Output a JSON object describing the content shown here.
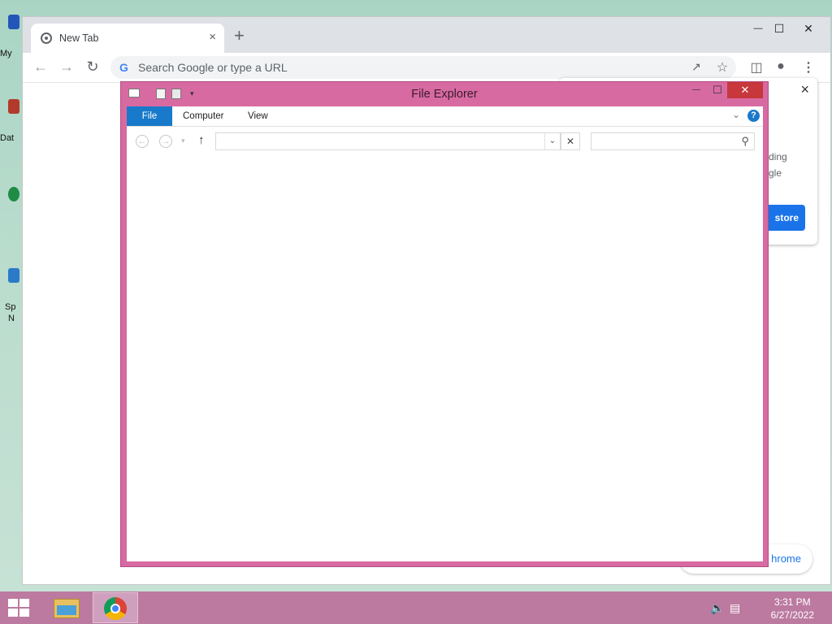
{
  "desktop": {
    "icons": [
      {
        "label": "My",
        "color": "#2356b8"
      },
      {
        "label": "Dat",
        "color": "#b33a2a"
      },
      {
        "label": "",
        "color": "#1e8c44"
      },
      {
        "label": "Sp",
        "color": "#2a7ac7"
      },
      {
        "label": "N",
        "color": "#2a7ac7"
      }
    ]
  },
  "chrome": {
    "tab_title": "New Tab",
    "tab_close": "×",
    "new_tab": "+",
    "omnibox_placeholder": "Search Google or type a URL",
    "omnibox_g": "G",
    "minimize": "—",
    "maximize": "☐",
    "close": "✕"
  },
  "popup": {
    "close": "×",
    "line1": "ding",
    "line2": "gle",
    "button": "store"
  },
  "bottom_pill": {
    "text": "hrome"
  },
  "file_explorer": {
    "title": "File Explorer",
    "tabs": [
      "File",
      "Computer",
      "View"
    ],
    "help": "?",
    "minimize": "—",
    "maximize": "☐",
    "close": "✕",
    "address_value": "",
    "search_value": ""
  },
  "taskbar": {
    "time": "3:31 PM",
    "date": "6/27/2022"
  },
  "colors": {
    "fe_frame": "#d86aa2",
    "fe_accent": "#1979ca",
    "taskbar": "#bc7aa0",
    "chrome_blue": "#1a73e8"
  }
}
